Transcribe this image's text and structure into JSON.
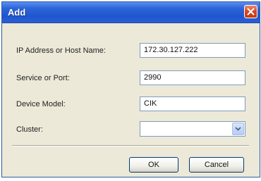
{
  "window": {
    "title": "Add"
  },
  "form": {
    "host": {
      "label": "IP Address or Host Name:",
      "value": "172.30.127.222"
    },
    "port": {
      "label": "Service or Port:",
      "value": "2990"
    },
    "device_model": {
      "label": "Device Model:",
      "value": "CIK"
    },
    "cluster": {
      "label": "Cluster:",
      "value": ""
    }
  },
  "buttons": {
    "ok": "OK",
    "cancel": "Cancel"
  },
  "colors": {
    "titlebar": "#2d64d8",
    "close": "#d6451f",
    "dialog_bg": "#ece9d8",
    "field_border": "#7f9db9"
  },
  "icons": {
    "close": "close-icon",
    "dropdown": "chevron-down-icon"
  }
}
